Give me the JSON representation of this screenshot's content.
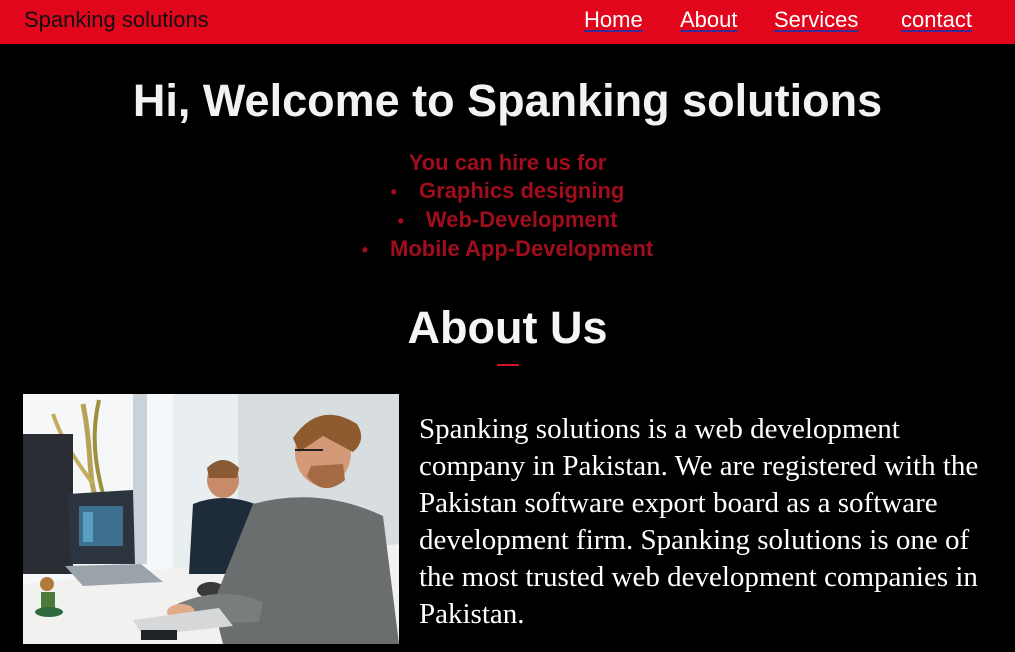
{
  "navbar": {
    "brand": "Spanking solutions",
    "links": [
      "Home",
      "About",
      "Services",
      "contact"
    ],
    "background_color": "#e2061c"
  },
  "hero": {
    "title": "Hi, Welcome to Spanking solutions",
    "intro": "You can hire us for",
    "services": [
      "Graphics designing",
      "Web-Development",
      "Mobile App-Development"
    ],
    "accent_color": "#a00d1c"
  },
  "about": {
    "heading": "About Us",
    "text": "Spanking solutions is a web development company in Pakistan. We are registered with the Pakistan software export board as a software development firm. Spanking solutions is one of the most trusted web development companies in Pakistan."
  }
}
